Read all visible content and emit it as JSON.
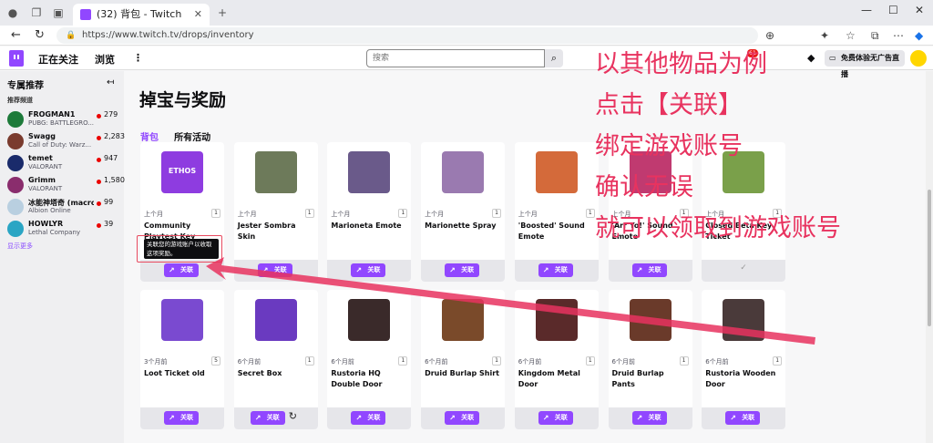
{
  "browser": {
    "tab_title": "(32) 背包 - Twitch",
    "url": "https://www.twitch.tv/drops/inventory"
  },
  "header": {
    "following": "正在关注",
    "browse": "浏览",
    "search_placeholder": "搜索",
    "notif_count": "61",
    "promo": "免费体验无广告直播"
  },
  "sidebar": {
    "title": "专属推荐",
    "subtitle": "推荐频道",
    "channels": [
      {
        "name": "FROGMAN1",
        "game": "PUBG: BATTLEGRO...",
        "viewers": "279",
        "color": "#1d7a3a"
      },
      {
        "name": "Swagg",
        "game": "Call of Duty: Warz...",
        "viewers": "2,283",
        "color": "#7a3b2e"
      },
      {
        "name": "temet",
        "game": "VALORANT",
        "viewers": "947",
        "color": "#1a2b6b"
      },
      {
        "name": "Grimm",
        "game": "VALORANT",
        "viewers": "1,580",
        "color": "#8a2d6d"
      },
      {
        "name": "冰能神塔奇 (macro...",
        "game": "Albion Online",
        "viewers": "99",
        "color": "#b9cfe0"
      },
      {
        "name": "HOWLYR",
        "game": "Lethal Company",
        "viewers": "39",
        "color": "#2aa5c4"
      }
    ],
    "show_more": "显示更多"
  },
  "main": {
    "title": "掉宝与奖励",
    "tabs": [
      "背包",
      "所有活动"
    ],
    "link_label": "关联",
    "tooltip": "关联您的游戏账户以收取这项奖励。",
    "row1": [
      {
        "time": "上个月",
        "count": "1",
        "name": "Community Playtest Key",
        "color": "#8e3ce0",
        "img_text": "ETHOS"
      },
      {
        "time": "上个月",
        "count": "1",
        "name": "Jester Sombra Skin",
        "color": "#6d7a5a"
      },
      {
        "time": "上个月",
        "count": "1",
        "name": "Marioneta Emote",
        "color": "#6a5a8a"
      },
      {
        "time": "上个月",
        "count": "1",
        "name": "Marionette Spray",
        "color": "#9a7ab0"
      },
      {
        "time": "上个月",
        "count": "1",
        "name": "'Boosted' Sound Emote",
        "color": "#d46a3a"
      },
      {
        "time": "上个月",
        "count": "1",
        "name": "'Arr Yo!' Sound Emote",
        "color": "#c03a70"
      },
      {
        "time": "上个月",
        "count": "1",
        "name": "Closed Beta Key Ticket",
        "color": "#7aa04a"
      }
    ],
    "row2": [
      {
        "time": "3个月前",
        "count": "5",
        "name": "Loot Ticket old",
        "color": "#7a4ad0"
      },
      {
        "time": "6个月前",
        "count": "1",
        "name": "Secret Box",
        "color": "#6a3ac0"
      },
      {
        "time": "6个月前",
        "count": "1",
        "name": "Rustoria HQ Double Door",
        "color": "#3a2a2a"
      },
      {
        "time": "6个月前",
        "count": "1",
        "name": "Druid Burlap Shirt",
        "color": "#7a4a2a"
      },
      {
        "time": "6个月前",
        "count": "1",
        "name": "Kingdom Metal Door",
        "color": "#5a2a2a"
      },
      {
        "time": "6个月前",
        "count": "1",
        "name": "Druid Burlap Pants",
        "color": "#6a3a2a"
      },
      {
        "time": "6个月前",
        "count": "1",
        "name": "Rustoria Wooden Door",
        "color": "#4a3a3a"
      }
    ]
  },
  "annotation": {
    "lines": [
      "以其他物品为例",
      "点击【关联】",
      "绑定游戏账号",
      "确认无误",
      "就可以领取到游戏账号"
    ],
    "color": "#e8335f"
  }
}
